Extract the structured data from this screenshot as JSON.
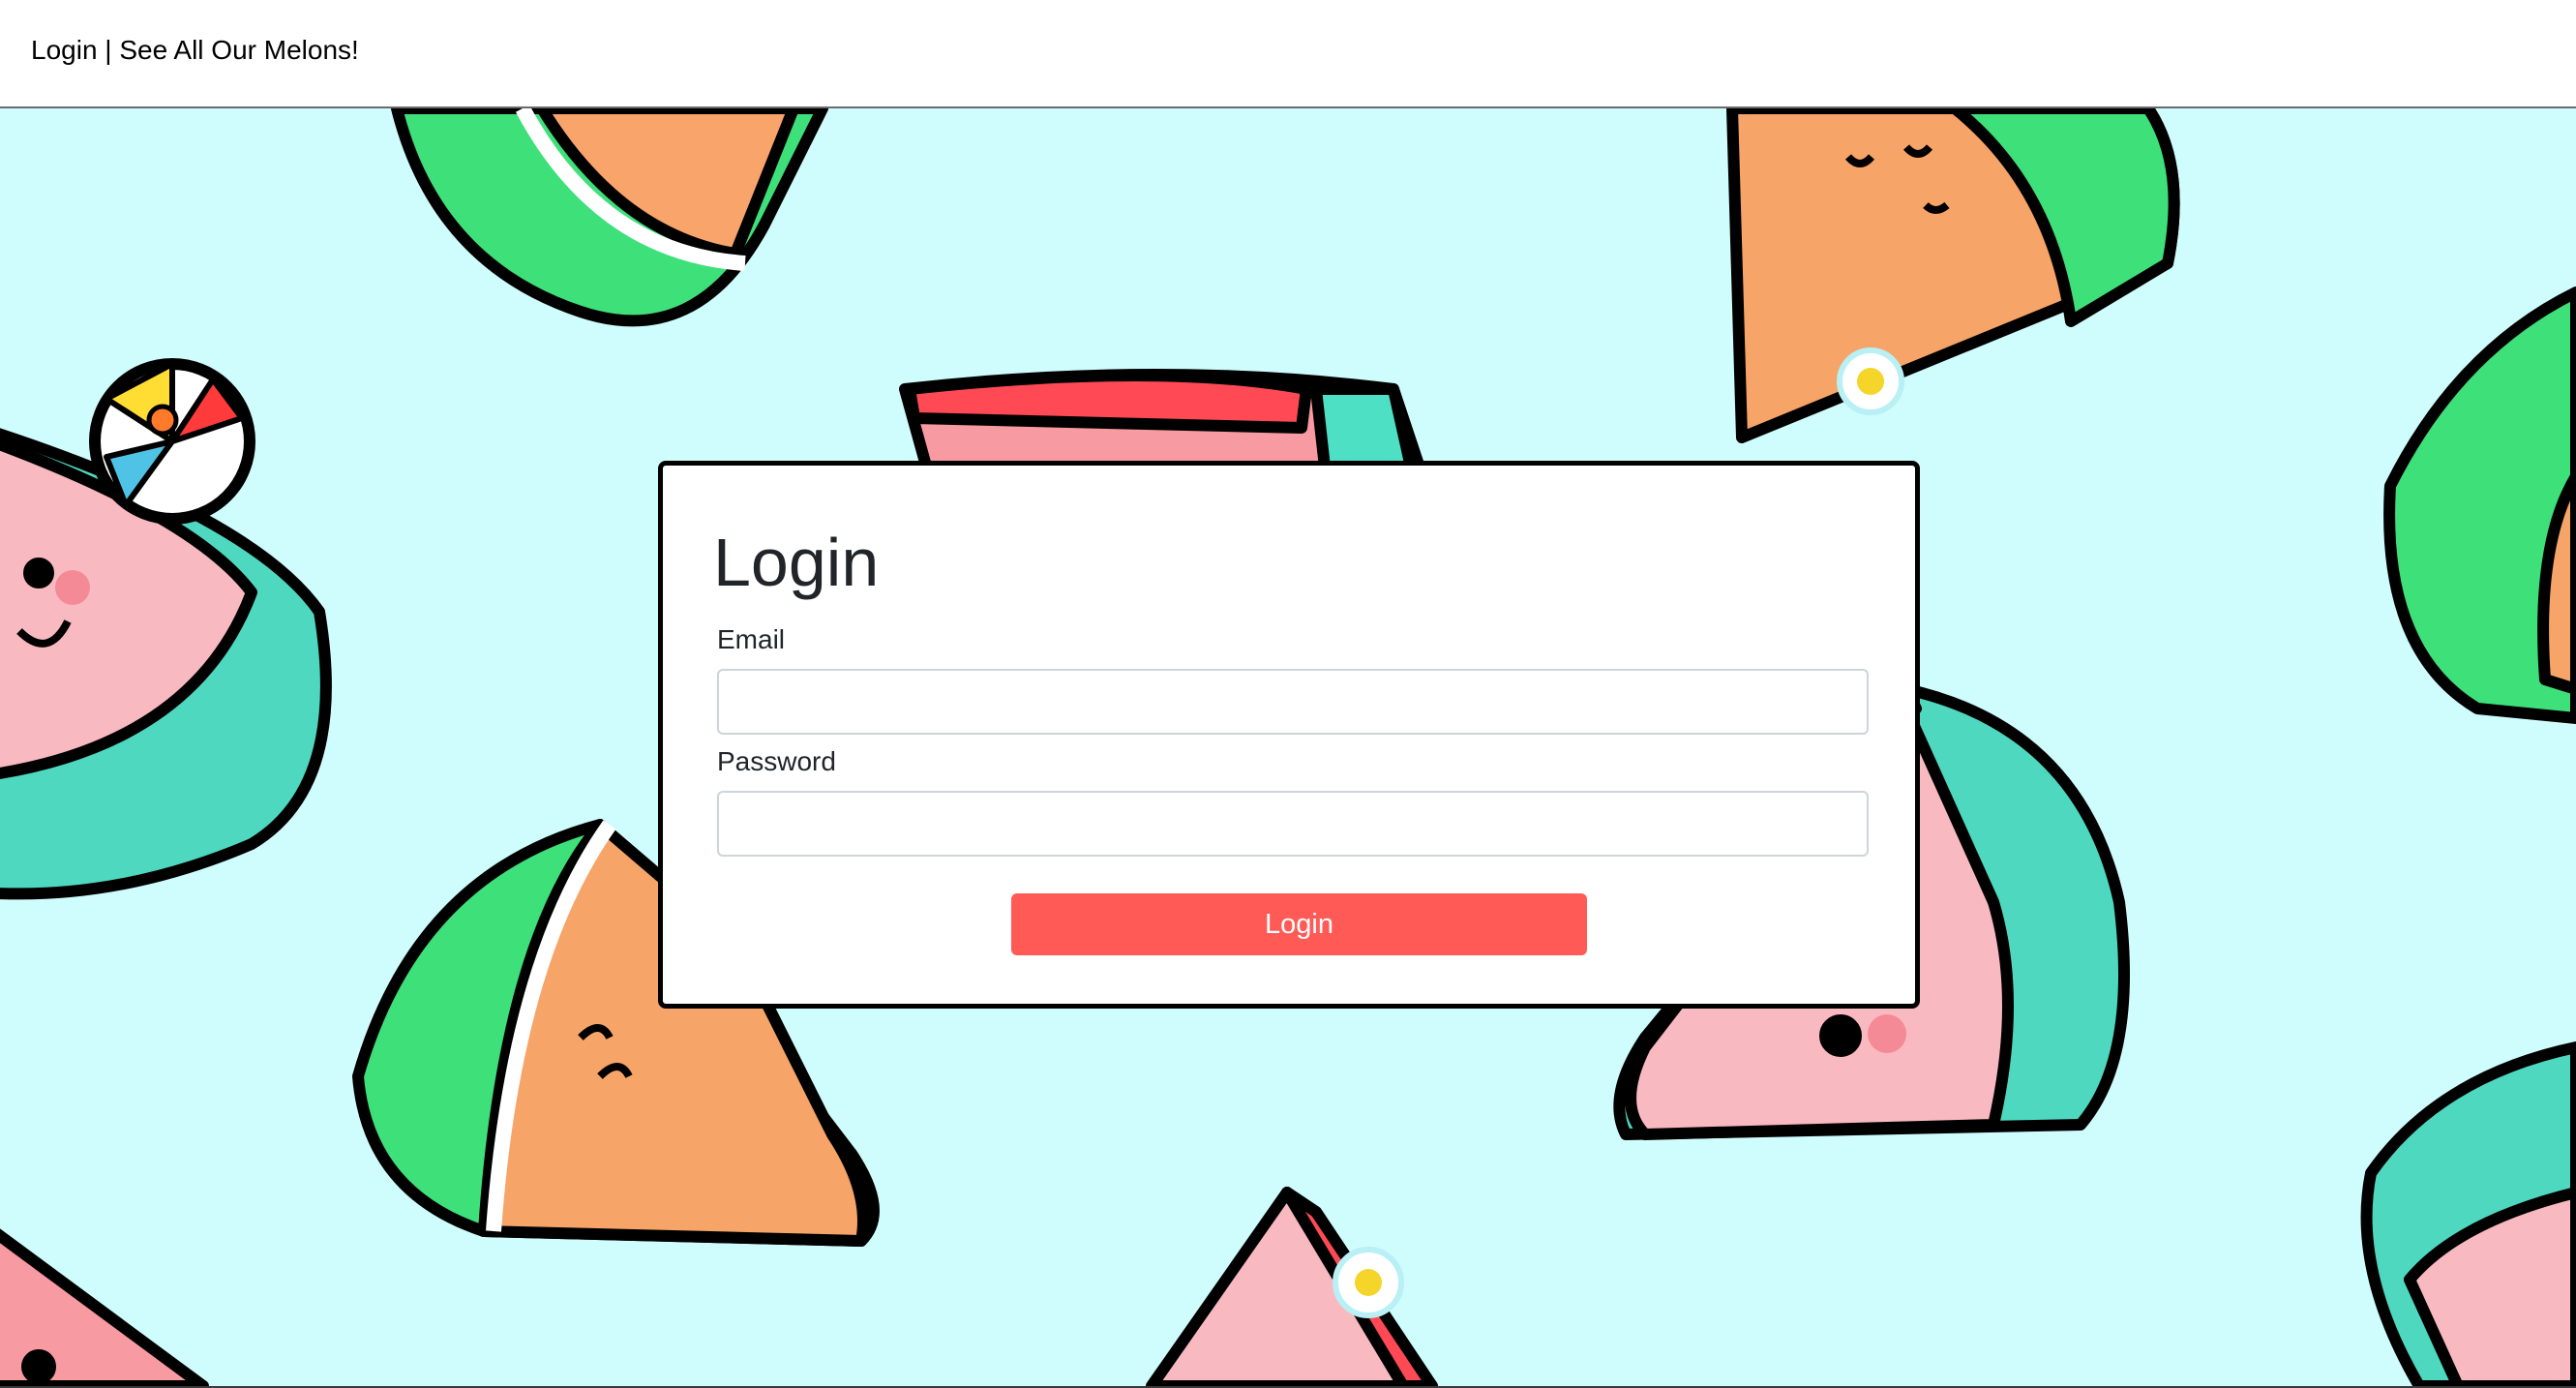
{
  "nav": {
    "title": "Login | See All Our Melons!"
  },
  "login": {
    "heading": "Login",
    "email_label": "Email",
    "email_value": "",
    "password_label": "Password",
    "password_value": "",
    "submit_label": "Login"
  },
  "colors": {
    "background": "#cffcfd",
    "button": "#ff5a55",
    "card_border": "#000000"
  }
}
